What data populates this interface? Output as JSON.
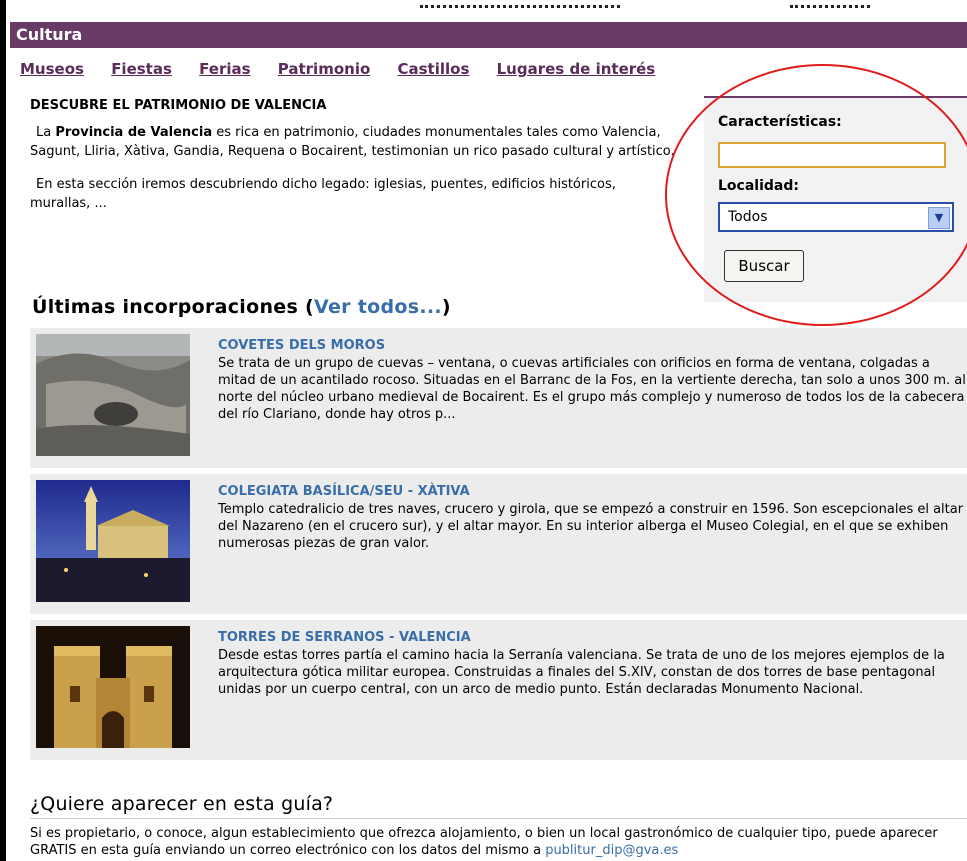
{
  "header": {
    "title": "Cultura"
  },
  "nav": [
    "Museos",
    "Fiestas",
    "Ferias",
    "Patrimonio",
    "Castillos",
    "Lugares de interés"
  ],
  "intro": {
    "heading": "DESCUBRE EL PATRIMONIO DE VALENCIA",
    "p1_prefix": "La ",
    "p1_bold": "Provincia de Valencia",
    "p1_rest": " es rica en patrimonio, ciudades monumentales tales como Valencia, Sagunt, Lliria, Xàtiva, Gandia, Requena o Bocairent, testimonian un rico pasado cultural y artístico.",
    "p2": "En esta sección iremos descubriendo dicho legado: iglesias, puentes, edificios históricos, murallas, ..."
  },
  "search": {
    "caracteristicas_label": "Características:",
    "caracteristicas_value": "",
    "localidad_label": "Localidad:",
    "localidad_selected": "Todos",
    "submit_label": "Buscar"
  },
  "ultimas": {
    "title": "Últimas incorporaciones (",
    "link": "Ver todos...",
    "close": ")"
  },
  "items": [
    {
      "title": "COVETES DELS MOROS",
      "text": "Se trata de un grupo de cuevas – ventana, o cuevas artificiales con orificios en forma de ventana, colgadas a mitad de un acantilado rocoso. Situadas en el Barranc de la Fos, en la vertiente derecha, tan solo a unos 300 m. al norte del núcleo urbano medieval de Bocairent. Es el grupo más complejo y numeroso de todos los de la cabecera del río Clariano, donde hay otros p..."
    },
    {
      "title": "COLEGIATA BASÍLICA/SEU - XÀTIVA",
      "text": "Templo catedralicio de tres naves, crucero y girola, que se empezó a construir en 1596. Son escepcionales el altar del Nazareno (en el crucero sur), y el altar mayor. En su interior alberga el Museo Colegial, en el que se exhiben numerosas piezas de gran valor."
    },
    {
      "title": "TORRES DE SERRANOS - VALENCIA",
      "text": "Desde estas torres partía el camino hacia la Serranía valenciana. Se trata de uno de los mejores ejemplos de la arquitectura gótica militar europea. Construidas a finales del S.XIV, constan de dos torres de base pentagonal unidas por un cuerpo central, con un arco de medio punto. Están declaradas Monumento Nacional."
    }
  ],
  "quiere": {
    "title": "¿Quiere aparecer en esta guía?",
    "text": "Si es propietario, o conoce, algun establecimiento que ofrezca alojamiento, o bien un local gastronómico de cualquier tipo,  puede aparecer GRATIS en esta guía enviando un correo electrónico con los datos del mismo a ",
    "email": "publitur_dip@gva.es"
  },
  "colors": {
    "header": "#6a3a67",
    "link": "#3a6ea8",
    "nav": "#5b2b5a",
    "annotation": "#e01c1c"
  },
  "icons": {
    "dropdown": "chevron-down-icon"
  }
}
